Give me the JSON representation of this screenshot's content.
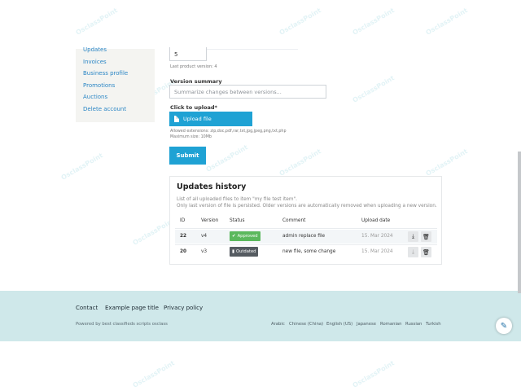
{
  "sidebar": {
    "items": [
      "Updates",
      "Invoices",
      "Business profile",
      "Promotions",
      "Auctions",
      "Delete account"
    ]
  },
  "form": {
    "version_value": "5",
    "last_version": "Last product version: 4",
    "summary_label": "Version summary",
    "summary_placeholder": "Summarize changes between versions...",
    "upload_label": "Click to upload*",
    "upload_button": "Upload file",
    "allowed_ext": "Allowed extensions: zip,doc,pdf,rar,txt,jpg,jpeg,png,txt,php",
    "max_size": "Maximum size: 10Mb",
    "submit": "Submit"
  },
  "history": {
    "title": "Updates history",
    "desc1": "List of all uploaded files to item \"my file test item\".",
    "desc2": "Only last version of file is persisted. Older versions are automatically removed when uploading a new version.",
    "columns": [
      "ID",
      "Version",
      "Status",
      "Comment",
      "Upload date"
    ],
    "rows": [
      {
        "id": "22",
        "version": "v4",
        "status": "Approved",
        "comment": "admin replace file",
        "date": "15. Mar 2024"
      },
      {
        "id": "20",
        "version": "v3",
        "status": "Outdated",
        "comment": "new file, some change",
        "date": "15. Mar 2024"
      }
    ]
  },
  "footer": {
    "links": [
      "Contact",
      "Example page title",
      "Privacy policy"
    ],
    "powered": "Powered by best classifieds scripts osclass",
    "languages": [
      "Arabic",
      "Chinese (China)",
      "English (US)",
      "Japanese",
      "Romanian",
      "Russian",
      "Turkish"
    ]
  },
  "watermark": "OsclassPoint",
  "colors": {
    "accent": "#1fa2d4",
    "approved": "#5bb85d",
    "outdated": "#555b61",
    "footer_bg": "#cfe8ea"
  },
  "icons": {
    "upload": "file-icon",
    "approved": "check-icon",
    "outdated": "file-icon",
    "download": "download-icon",
    "delete": "trash-icon",
    "fab": "brush-icon"
  }
}
